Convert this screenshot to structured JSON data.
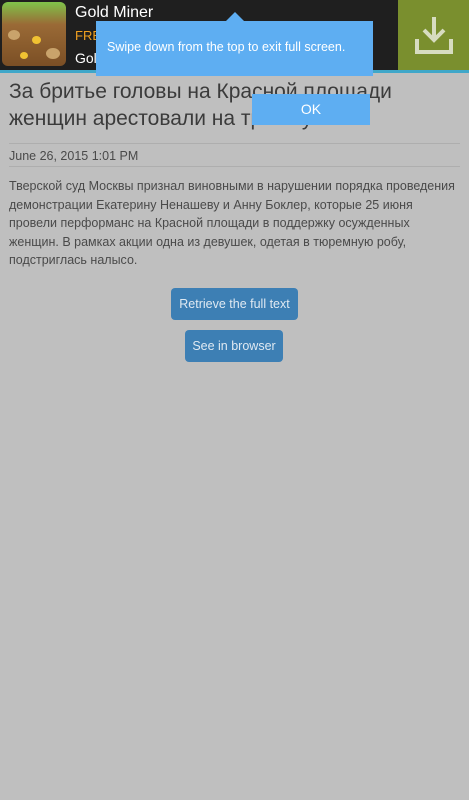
{
  "ad": {
    "app_name": "Gold Miner",
    "price": "FRE",
    "publisher": "Gol",
    "download_icon": "download-icon"
  },
  "tooltip": {
    "message": "Swipe down from the top to exit full screen.",
    "ok_label": "OK"
  },
  "article": {
    "title": "За бритье головы на Красной площади женщин арестовали на трое суток",
    "date": "June 26, 2015 1:01 PM",
    "body": "Тверской суд Москвы признал виновными в нарушении порядка проведения демонстрации Екатерину Ненашеву и Анну Боклер, которые 25 июня провели перформанс на Красной площади в поддержку осужденных женщин. В рамках акции одна из девушек, одетая в тюремную робу, подстриглась налысо.",
    "retrieve_label": "Retrieve the full text",
    "browser_label": "See in browser"
  }
}
